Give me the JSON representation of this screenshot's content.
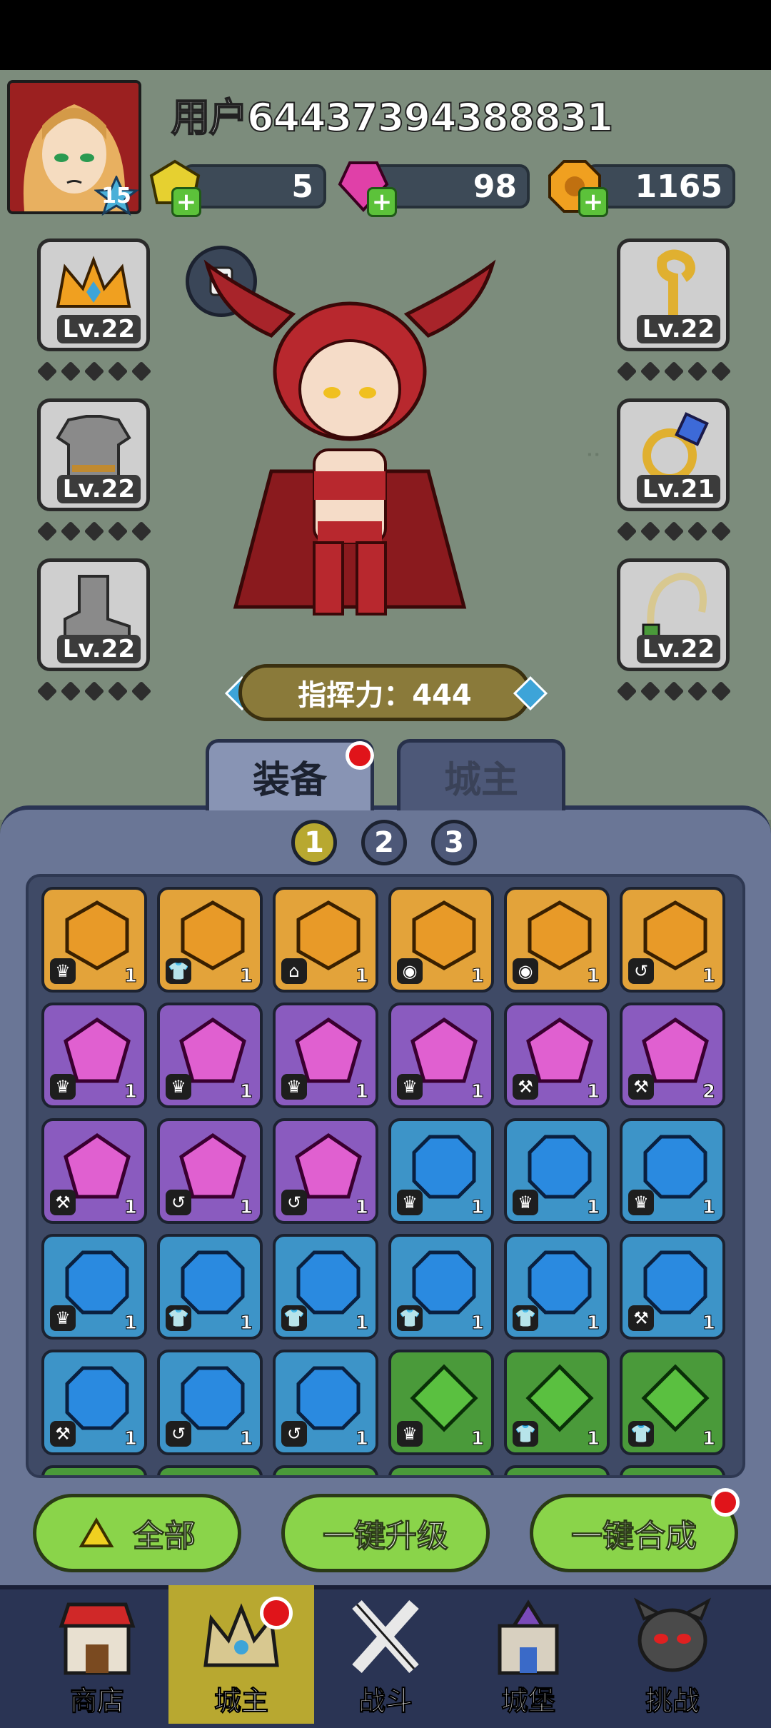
{
  "user": {
    "name": "用户64437394388831",
    "level": "15"
  },
  "resources": {
    "yellow_gem": "5",
    "pink_gem": "98",
    "gold": "1165"
  },
  "equipment": {
    "left": [
      {
        "lv": "Lv.22"
      },
      {
        "lv": "Lv.22"
      },
      {
        "lv": "Lv.22"
      }
    ],
    "right": [
      {
        "lv": "Lv.22"
      },
      {
        "lv": "Lv.21"
      },
      {
        "lv": "Lv.22"
      }
    ]
  },
  "power": "指挥力：444",
  "tabs": {
    "equip": "装备",
    "lord": "城主"
  },
  "pages": [
    "1",
    "2",
    "3"
  ],
  "gems": [
    {
      "color": "orange",
      "count": "1"
    },
    {
      "color": "orange",
      "count": "1"
    },
    {
      "color": "orange",
      "count": "1"
    },
    {
      "color": "orange",
      "count": "1"
    },
    {
      "color": "orange",
      "count": "1"
    },
    {
      "color": "orange",
      "count": "1"
    },
    {
      "color": "purple",
      "count": "1"
    },
    {
      "color": "purple",
      "count": "1"
    },
    {
      "color": "purple",
      "count": "1"
    },
    {
      "color": "purple",
      "count": "1"
    },
    {
      "color": "purple",
      "count": "1"
    },
    {
      "color": "purple",
      "count": "2"
    },
    {
      "color": "purple",
      "count": "1"
    },
    {
      "color": "purple",
      "count": "1"
    },
    {
      "color": "purple",
      "count": "1"
    },
    {
      "color": "blue",
      "count": "1"
    },
    {
      "color": "blue",
      "count": "1"
    },
    {
      "color": "blue",
      "count": "1"
    },
    {
      "color": "blue",
      "count": "1"
    },
    {
      "color": "blue",
      "count": "1"
    },
    {
      "color": "blue",
      "count": "1"
    },
    {
      "color": "blue",
      "count": "1"
    },
    {
      "color": "blue",
      "count": "1"
    },
    {
      "color": "blue",
      "count": "1"
    },
    {
      "color": "blue",
      "count": "1"
    },
    {
      "color": "blue",
      "count": "1"
    },
    {
      "color": "blue",
      "count": "1"
    },
    {
      "color": "green",
      "count": "1"
    },
    {
      "color": "green",
      "count": "1"
    },
    {
      "color": "green",
      "count": "1"
    }
  ],
  "actions": {
    "all": "全部",
    "upgrade": "一键升级",
    "merge": "一键合成"
  },
  "nav": {
    "shop": "商店",
    "lord": "城主",
    "battle": "战斗",
    "castle": "城堡",
    "challenge": "挑战"
  },
  "colors": {
    "orange": "#e3a33a",
    "purple": "#8a5bbf",
    "blue": "#3d94c8",
    "green": "#4a9a3a"
  }
}
